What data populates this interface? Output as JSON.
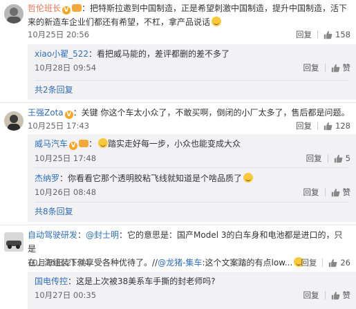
{
  "actions": {
    "reply": "回复",
    "like": "赞"
  },
  "c1": {
    "user": "哲伦班长",
    "text": "：把特斯拉邀到中国制造，正是希望刺激中国制造，提升中国制造，活下来的新造车企业们都还有希望，不杠，拿产品说话",
    "time": "10月25日 20:56",
    "likes": "158",
    "sub1": {
      "user": "xiao小翟_522",
      "text": "：看把威马能的，差评都删的差不多了",
      "time": "10月28日 09:54"
    },
    "more": "共2条回复"
  },
  "c2": {
    "user": "王强Zota",
    "text": "：关键 你这个车太小众了，不敢买啊，倒闭的小厂太多了，售后都是问题。",
    "time": "10月25日 17:43",
    "likes": "128",
    "sub1": {
      "user": "威马汽车",
      "text": "踏实走好每一步，小众也能变成大众",
      "time": "10月25日 17:48",
      "likes": "5"
    },
    "sub2": {
      "user": "杰纳罗",
      "text": "：你看看它那个透明胶粘飞线就知道是个啥品质了",
      "time": "10月26日 08:48"
    },
    "more": "共8条回复"
  },
  "c3": {
    "user": "自动驾驶研发",
    "mention1": "@封士明",
    "text1": "：它的意思是：国产Model 3的白车身和电池都是进口的，只是",
    "text2a": "在上海组装下就享受各种优待了。//",
    "mention2": "@龙猪-集车",
    "text2b": ":这个文案踏的有点low...",
    "time": "10月25日 21:44",
    "likes": "26",
    "sub1": {
      "user": "国电传控",
      "text": "：这是上次被38美系车手撕的封老师吗?",
      "time": "10月27日 00:35"
    }
  }
}
